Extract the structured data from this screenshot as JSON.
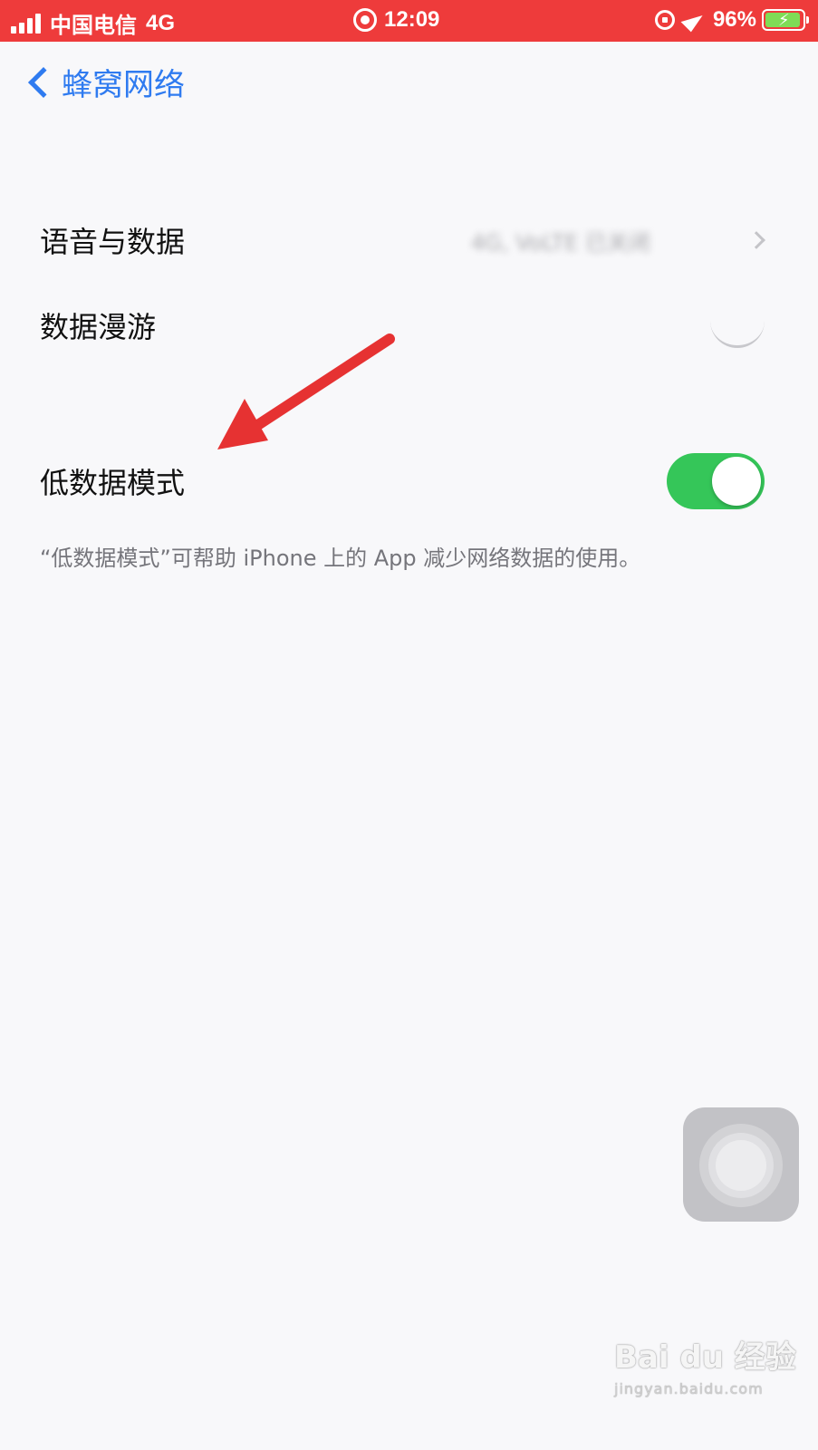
{
  "status_bar": {
    "carrier": "中国电信",
    "network": "4G",
    "time": "12:09",
    "battery_percent": "96%",
    "battery_level": 0.96,
    "background_color": "#ee3b3b"
  },
  "nav": {
    "back_label": "蜂窝网络",
    "accent_color": "#2f7bf0"
  },
  "settings": {
    "voice_data": {
      "label": "语音与数据",
      "value": "4G, VoLTE 已关闭"
    },
    "data_roaming": {
      "label": "数据漫游",
      "state": "off"
    },
    "low_data_mode": {
      "label": "低数据模式",
      "state": "on",
      "on_color": "#35c659"
    },
    "footnote": "“低数据模式”可帮助 iPhone 上的 App 减少网络数据的使用。"
  },
  "annotation": {
    "arrow_color": "#e63232"
  },
  "assistive_touch": {
    "icon": "assistive-touch-icon"
  },
  "watermark": {
    "main": "Bai du 经验",
    "sub": "jingyan.baidu.com"
  }
}
